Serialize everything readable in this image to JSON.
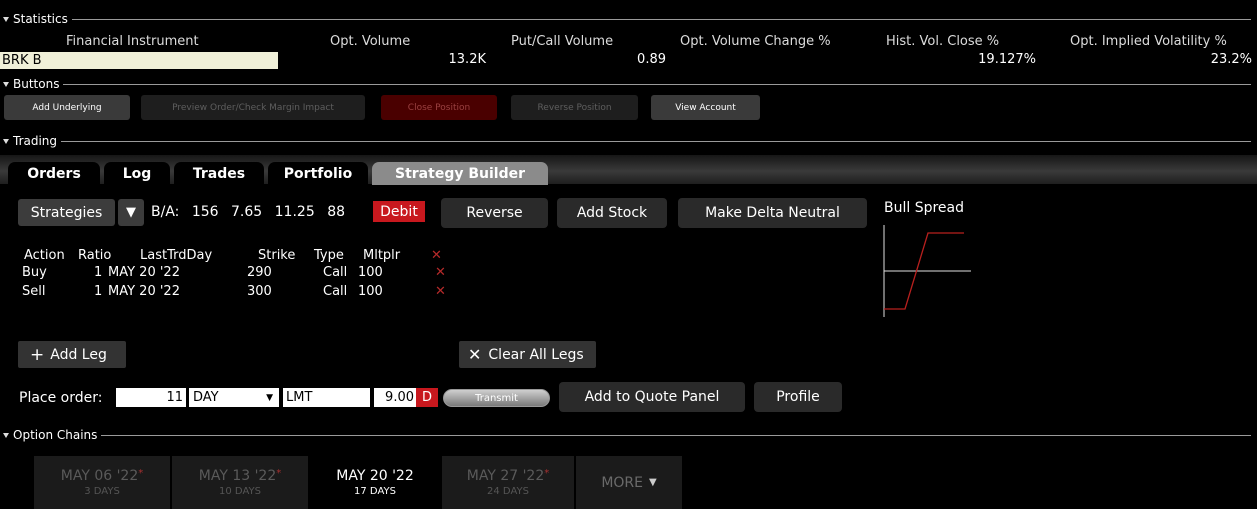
{
  "statistics": {
    "section_label": "Statistics",
    "headers": [
      "Financial Instrument",
      "Opt. Volume",
      "Put/Call Volume",
      "Opt. Volume Change %",
      "Hist. Vol. Close %",
      "Opt. Implied Volatility %"
    ],
    "instrument": "BRK B",
    "opt_volume": "13.2K",
    "put_call_volume": "0.89",
    "opt_volume_change": "",
    "hist_vol_close": "19.127%",
    "implied_vol": "23.2%"
  },
  "buttons": {
    "section_label": "Buttons",
    "add_underlying": "Add Underlying",
    "preview_order": "Preview Order/Check Margin Impact",
    "close_position": "Close Position",
    "reverse_position": "Reverse Position",
    "view_account": "View Account"
  },
  "trading": {
    "section_label": "Trading",
    "tabs": [
      "Orders",
      "Log",
      "Trades",
      "Portfolio",
      "Strategy Builder"
    ],
    "active_tab": "Strategy Builder"
  },
  "strategy": {
    "strategies_label": "Strategies",
    "ba_label": "B/A:",
    "ba_values": [
      "156",
      "7.65",
      "11.25",
      "88"
    ],
    "debit_label": "Debit",
    "reverse_label": "Reverse",
    "add_stock_label": "Add Stock",
    "delta_neutral_label": "Make Delta Neutral",
    "profile_title": "Bull Spread",
    "leg_headers": {
      "action": "Action",
      "ratio": "Ratio",
      "last_trd_day": "LastTrdDay",
      "strike": "Strike",
      "type": "Type",
      "mltplr": "Mltplr"
    },
    "legs": [
      {
        "action": "Buy",
        "ratio": "1",
        "last_trd_day": "MAY 20 '22",
        "strike": "290",
        "type": "Call",
        "mltplr": "100"
      },
      {
        "action": "Sell",
        "ratio": "1",
        "last_trd_day": "MAY 20 '22",
        "strike": "300",
        "type": "Call",
        "mltplr": "100"
      }
    ],
    "remove_icon": "✕",
    "add_leg_label": "Add Leg",
    "clear_legs_label": "Clear All Legs"
  },
  "order": {
    "place_label": "Place order:",
    "quantity": "11",
    "tif": "DAY",
    "order_type": "LMT",
    "price": "9.00",
    "price_flag": "D",
    "transmit_label": "Transmit",
    "add_quote_label": "Add to Quote Panel",
    "profile_label": "Profile"
  },
  "option_chains": {
    "section_label": "Option Chains",
    "expirations": [
      {
        "date": "MAY 06 '22",
        "days": "3 DAYS",
        "flag": "*"
      },
      {
        "date": "MAY 13 '22",
        "days": "10 DAYS",
        "flag": "*"
      },
      {
        "date": "MAY 20 '22",
        "days": "17 DAYS",
        "flag": ""
      },
      {
        "date": "MAY 27 '22",
        "days": "24 DAYS",
        "flag": "*"
      }
    ],
    "more_label": "MORE"
  },
  "colors": {
    "accent_red": "#c8181e",
    "instrument_bg": "#f0f0d8",
    "active_tab": "#8b8b8b"
  }
}
